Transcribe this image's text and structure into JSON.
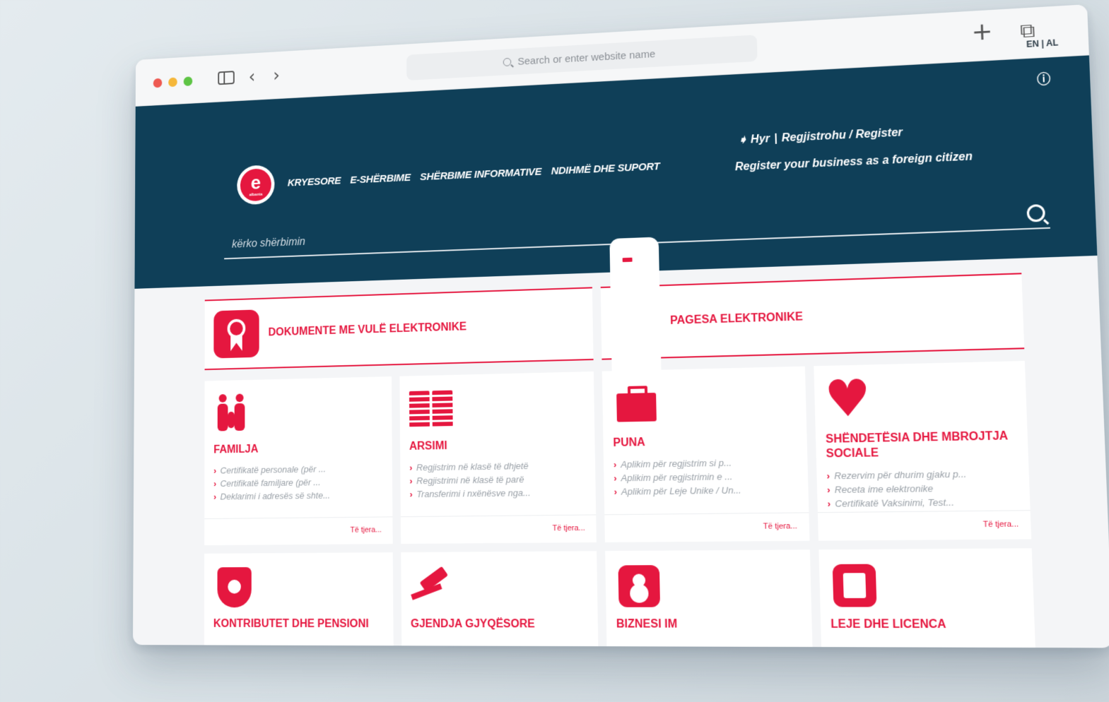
{
  "browser": {
    "address_placeholder": "Search or enter website name",
    "new_tab_label": "+",
    "tabs_label": "⧉"
  },
  "header": {
    "lang": "EN | AL",
    "nav": [
      "KRYESORE",
      "E-SHËRBIME",
      "SHËRBIME INFORMATIVE",
      "NDIHMË DHE SUPORT"
    ],
    "login": "Hyr",
    "register": "Regjistrohu / Register",
    "register_business": "Register your business as a foreign citizen",
    "logo_letter": "e",
    "logo_sub": "albania",
    "search_placeholder": "kërko shërbimin"
  },
  "features": [
    {
      "title": "DOKUMENTE ME VULË ELEKTRONIKE",
      "icon": "medal-icon"
    },
    {
      "title": "PAGESA ELEKTRONIKE",
      "icon": "card-icon"
    }
  ],
  "categories": [
    {
      "title": "FAMILJA",
      "icon": "family-icon",
      "items": [
        "Certifikatë personale (për ...",
        "Certifikatë familjare (për ...",
        "Deklarimi i adresës së shte..."
      ],
      "more": "Të tjera..."
    },
    {
      "title": "ARSIMI",
      "icon": "book-icon",
      "items": [
        "Regjistrim në klasë të dhjetë",
        "Regjistrimi në klasë të parë",
        "Transferimi i nxënësve nga..."
      ],
      "more": "Të tjera..."
    },
    {
      "title": "PUNA",
      "icon": "briefcase-icon",
      "items": [
        "Aplikim për regjistrim si p...",
        "Aplikim për regjistrimin e ...",
        "Aplikim për Leje Unike / Un..."
      ],
      "more": "Të tjera..."
    },
    {
      "title": "SHËNDETËSIA DHE MBROJTJA SOCIALE",
      "icon": "heart-icon",
      "items": [
        "Rezervim për dhurim gjaku p...",
        "Receta ime elektronike",
        "Certifikatë Vaksinimi, Test..."
      ],
      "more": "Të tjera..."
    },
    {
      "title": "KONTRIBUTET DHE PENSIONI",
      "icon": "shield-family-icon"
    },
    {
      "title": "GJENDJA GJYQËSORE",
      "icon": "gavel-icon"
    },
    {
      "title": "BIZNESI IM",
      "icon": "user-icon"
    },
    {
      "title": "LEJE DHE LICENCA",
      "icon": "license-icon"
    }
  ]
}
